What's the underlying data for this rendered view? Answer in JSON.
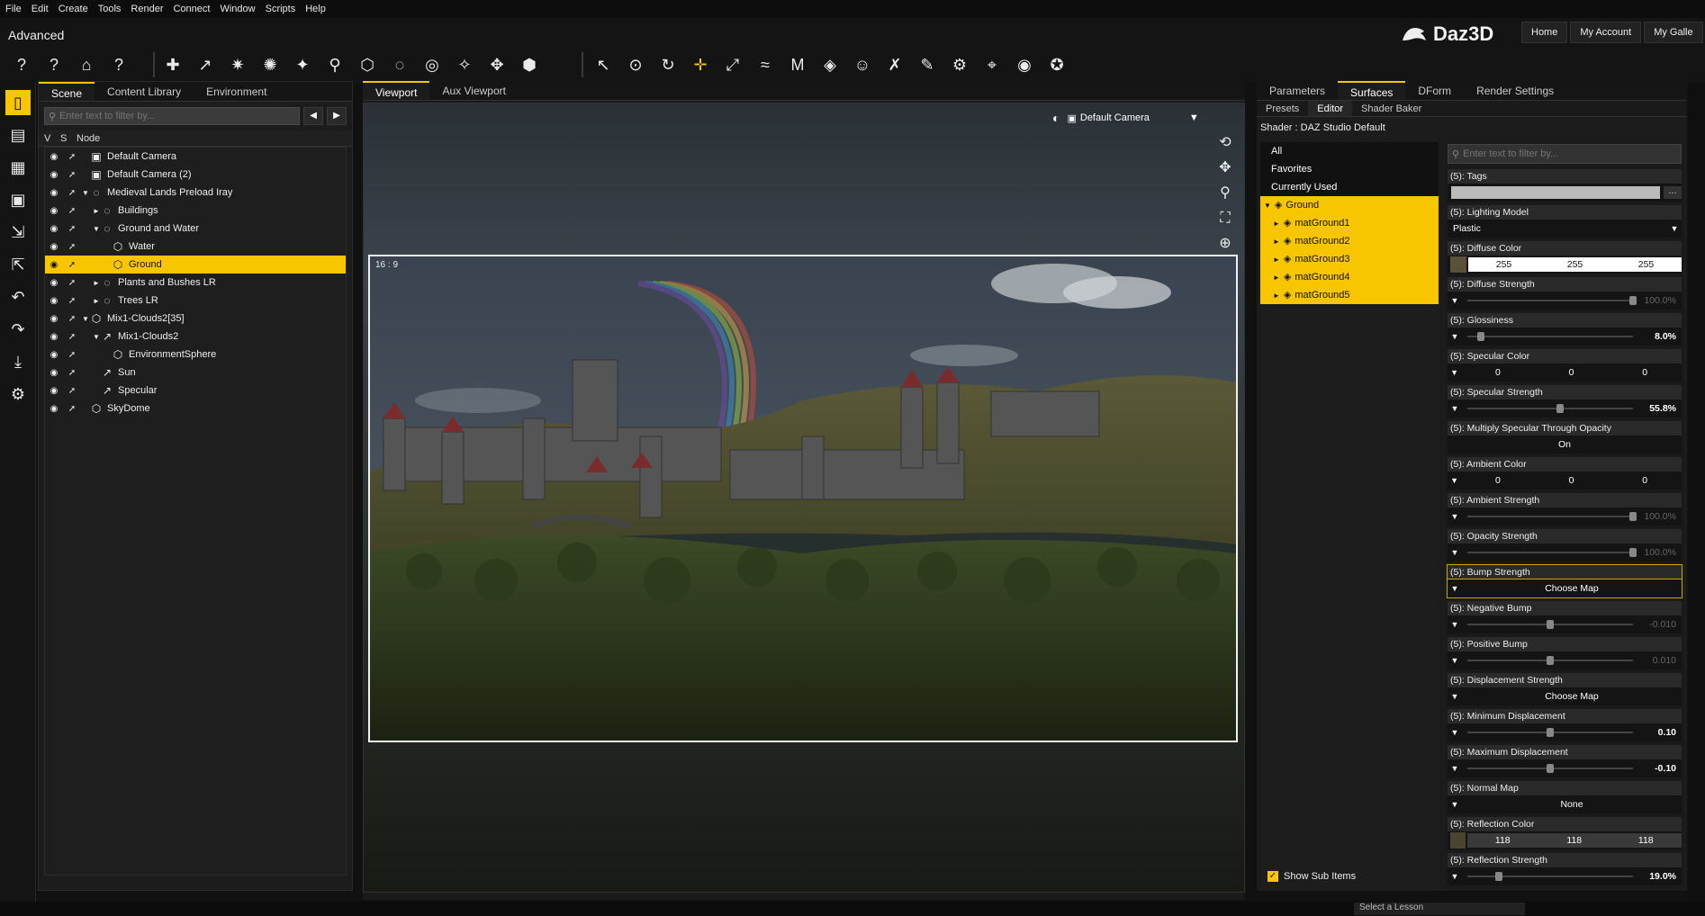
{
  "menu": [
    "File",
    "Edit",
    "Create",
    "Tools",
    "Render",
    "Connect",
    "Window",
    "Scripts",
    "Help"
  ],
  "layout_name": "Advanced",
  "brand": "Daz3D",
  "top_nav": [
    "Home",
    "My Account",
    "My Galle"
  ],
  "scene": {
    "tabs": [
      "Scene",
      "Content Library",
      "Environment"
    ],
    "filter_placeholder": "Enter text to filter by...",
    "columns": [
      "V",
      "S",
      "Node"
    ],
    "nodes": [
      {
        "label": "Default Camera",
        "twisty": "",
        "indent": 0,
        "icon": "camera"
      },
      {
        "label": "Default Camera (2)",
        "twisty": "",
        "indent": 0,
        "icon": "camera"
      },
      {
        "label": "Medieval Lands Preload Iray",
        "twisty": "▼",
        "indent": 0,
        "icon": "group"
      },
      {
        "label": "Buildings",
        "twisty": "►",
        "indent": 1,
        "icon": "group"
      },
      {
        "label": "Ground and Water",
        "twisty": "▼",
        "indent": 1,
        "icon": "group"
      },
      {
        "label": "Water",
        "twisty": "",
        "indent": 2,
        "icon": "object"
      },
      {
        "label": "Ground",
        "twisty": "",
        "indent": 2,
        "icon": "object",
        "selected": true
      },
      {
        "label": "Plants and Bushes LR",
        "twisty": "►",
        "indent": 1,
        "icon": "group"
      },
      {
        "label": "Trees LR",
        "twisty": "►",
        "indent": 1,
        "icon": "group"
      },
      {
        "label": "Mix1-Clouds2[35]",
        "twisty": "▼",
        "indent": 0,
        "icon": "object"
      },
      {
        "label": "Mix1-Clouds2",
        "twisty": "▼",
        "indent": 1,
        "icon": "light"
      },
      {
        "label": "EnvironmentSphere",
        "twisty": "",
        "indent": 2,
        "icon": "object"
      },
      {
        "label": "Sun",
        "twisty": "",
        "indent": 1,
        "icon": "light"
      },
      {
        "label": "Specular",
        "twisty": "",
        "indent": 1,
        "icon": "light"
      },
      {
        "label": "SkyDome",
        "twisty": "",
        "indent": 0,
        "icon": "object"
      }
    ]
  },
  "viewport": {
    "tabs": [
      "Viewport",
      "Aux Viewport"
    ],
    "camera": "Default Camera",
    "aspect": "16 : 9"
  },
  "right": {
    "tabs": [
      "Parameters",
      "Surfaces",
      "DForm",
      "Render Settings"
    ],
    "subtabs": [
      "Presets",
      "Editor",
      "Shader Baker"
    ],
    "shader": "Shader : DAZ Studio Default",
    "filter_placeholder": "Enter text to filter by...",
    "categories": [
      "All",
      "Favorites",
      "Currently Used"
    ],
    "materials": [
      "Ground",
      "matGround1",
      "matGround2",
      "matGround3",
      "matGround4",
      "matGround5"
    ],
    "show_sub_items": "Show Sub Items",
    "properties": [
      {
        "label": "(5): Tags",
        "kind": "tags"
      },
      {
        "label": "(5): Lighting Model",
        "kind": "select",
        "value": "Plastic"
      },
      {
        "label": "(5): Diffuse Color",
        "kind": "color_white",
        "rgb": [
          "255",
          "255",
          "255"
        ],
        "swatch": "#5a5238"
      },
      {
        "label": "(5): Diffuse Strength",
        "kind": "slider",
        "value": "100.0%",
        "pos": 1.0,
        "dim": true
      },
      {
        "label": "(5): Glossiness",
        "kind": "slider",
        "value": "8.0%",
        "pos": 0.08
      },
      {
        "label": "(5): Specular Color",
        "kind": "color",
        "rgb": [
          "0",
          "0",
          "0"
        ]
      },
      {
        "label": "(5): Specular Strength",
        "kind": "slider",
        "value": "55.8%",
        "pos": 0.558
      },
      {
        "label": "(5): Multiply Specular Through Opacity",
        "kind": "toggle",
        "value": "On"
      },
      {
        "label": "(5): Ambient Color",
        "kind": "color",
        "rgb": [
          "0",
          "0",
          "0"
        ]
      },
      {
        "label": "(5): Ambient Strength",
        "kind": "slider",
        "value": "100.0%",
        "pos": 1.0,
        "dim": true
      },
      {
        "label": "(5): Opacity Strength",
        "kind": "slider",
        "value": "100.0%",
        "pos": 1.0,
        "dim": true
      },
      {
        "label": "(5): Bump Strength",
        "kind": "map",
        "value": "Choose Map",
        "highlight": true
      },
      {
        "label": "(5): Negative Bump",
        "kind": "slider",
        "value": "-0.010",
        "pos": 0.5,
        "dim": true
      },
      {
        "label": "(5): Positive Bump",
        "kind": "slider",
        "value": "0.010",
        "pos": 0.5,
        "dim": true
      },
      {
        "label": "(5): Displacement Strength",
        "kind": "map",
        "value": "Choose Map"
      },
      {
        "label": "(5): Minimum Displacement",
        "kind": "slider",
        "value": "0.10",
        "pos": 0.5
      },
      {
        "label": "(5): Maximum Displacement",
        "kind": "slider",
        "value": "-0.10",
        "pos": 0.5
      },
      {
        "label": "(5): Normal Map",
        "kind": "map",
        "value": "None"
      },
      {
        "label": "(5): Reflection Color",
        "kind": "color_swatch",
        "rgb": [
          "118",
          "118",
          "118"
        ],
        "swatch": "#4a4530"
      },
      {
        "label": "(5): Reflection Strength",
        "kind": "slider",
        "value": "19.0%",
        "pos": 0.19
      }
    ]
  },
  "status": {
    "lesson": "Select a Lesson"
  },
  "colors": {
    "accent": "#f7c600",
    "panel": "#1c1c1c",
    "bg": "#111111"
  }
}
